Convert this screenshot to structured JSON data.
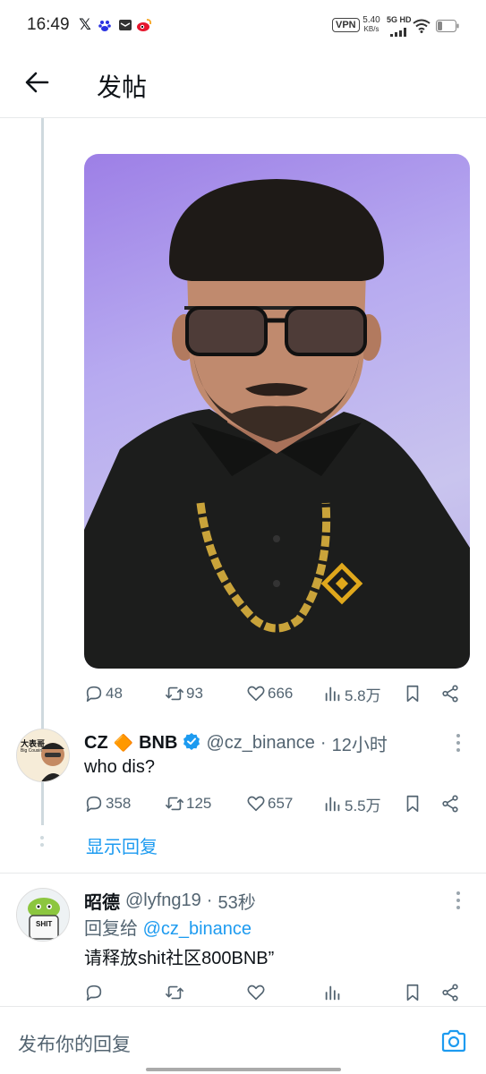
{
  "status_bar": {
    "time": "16:49",
    "vpn": "VPN",
    "speed_value": "5.40",
    "speed_unit": "KB/s",
    "network": "5G HD",
    "icons": [
      "x-icon",
      "baidu-icon",
      "mail-icon",
      "weibo-icon",
      "signal-icon",
      "wifi-icon",
      "battery-icon"
    ]
  },
  "header": {
    "title": "发帖",
    "back_icon": "arrow-left-icon"
  },
  "main_post": {
    "image_desc_icon": "photo",
    "actions": {
      "replies": "48",
      "reposts": "93",
      "likes": "666",
      "views": "5.8万"
    }
  },
  "reply_cz": {
    "name": "CZ",
    "badge_emoji": "🔶",
    "name_suffix": "BNB",
    "handle": "@cz_binance",
    "separator": "·",
    "time": "12小时",
    "text": "who dis?",
    "avatar_text_1": "大表哥",
    "avatar_text_2": "Big Cousin",
    "actions": {
      "replies": "358",
      "reposts": "125",
      "likes": "657",
      "views": "5.5万"
    }
  },
  "show_replies": "显示回复",
  "reply_zhaode": {
    "name": "昭德",
    "handle": "@lyfng19",
    "separator": "·",
    "time": "53秒",
    "reply_to_label": "回复给",
    "reply_to_handle": "@cz_binance",
    "text": "请释放shit社区800BNB”",
    "avatar_text": "SHIT"
  },
  "composer": {
    "placeholder": "发布你的回复",
    "camera_icon": "camera-icon"
  },
  "colors": {
    "accent": "#1d9bf0",
    "muted": "#536471",
    "divider": "#e7e9ea",
    "verified": "#1d9bf0",
    "bnb_yellow": "#f0b90b"
  }
}
